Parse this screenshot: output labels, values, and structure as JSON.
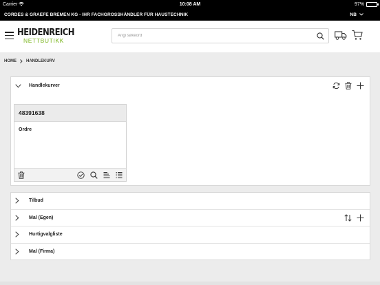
{
  "status_bar": {
    "carrier": "Carrier",
    "time": "10:08 AM",
    "battery": "97%",
    "battery_level": 0.97
  },
  "top_bar": {
    "company": "CORDES & GRAEFE BREMEN KG - IHR FACHGROSSHÄNDLER FÜR HAUSTECHNIK",
    "language": "NB"
  },
  "header": {
    "logo_brand": "HEIDENREICH",
    "logo_sub": "NETTBUTIKK",
    "search_placeholder": "Angi søkeord"
  },
  "breadcrumb": {
    "home": "HOME",
    "current": "HANDLEKURV"
  },
  "handlekurver": {
    "title": "Handlekurver",
    "card": {
      "number": "48391638",
      "label": "Ordre"
    }
  },
  "sections": [
    {
      "label": "Tilbud"
    },
    {
      "label": "Mal (Egen)"
    },
    {
      "label": "Hurtigvalgliste"
    },
    {
      "label": "Mal (Firma)"
    }
  ]
}
